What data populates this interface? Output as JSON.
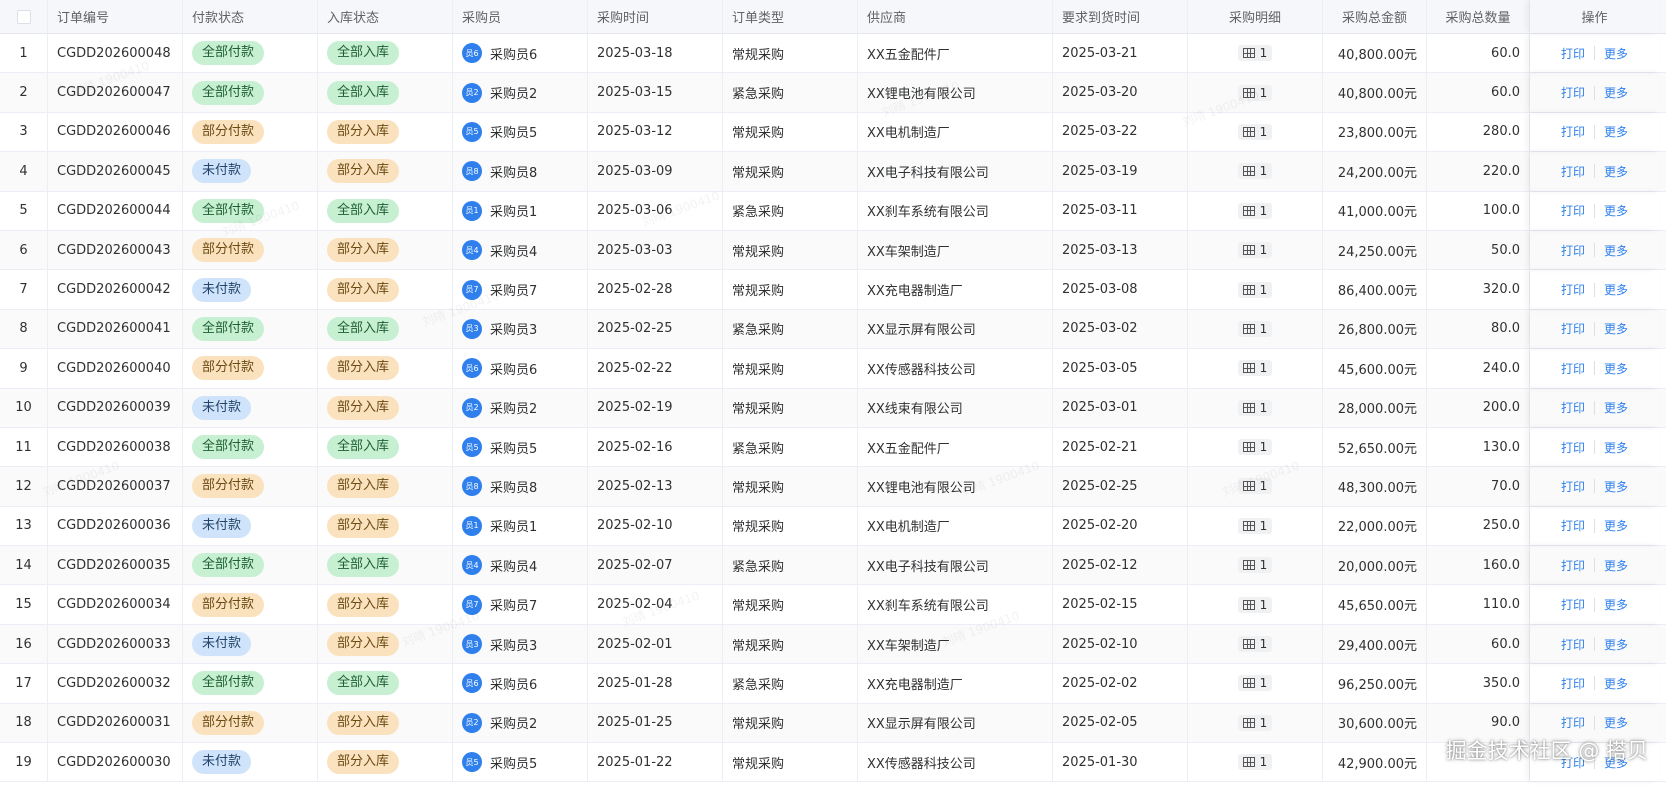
{
  "columns": [
    "",
    "订单编号",
    "付款状态",
    "入库状态",
    "采购员",
    "采购时间",
    "订单类型",
    "供应商",
    "要求到货时间",
    "采购明细",
    "采购总金额",
    "采购总数量",
    "操作"
  ],
  "actions": {
    "print": "打印",
    "more": "更多"
  },
  "watermark": "刘晴 1900410",
  "brand": "掘金技术社区 @ 搭贝",
  "colors": {
    "accent": "#2f80ed",
    "green_tag": "#c7efd2",
    "orange_tag": "#fbe2bf",
    "blue_tag": "#cfe3fb"
  },
  "rows": [
    {
      "idx": "1",
      "order": "CGDD202600048",
      "pay": "全部付款",
      "pay_color": "green",
      "stock": "全部入库",
      "stock_color": "green",
      "avatar": "员6",
      "buyer": "采购员6",
      "date": "2025-03-18",
      "type": "常规采购",
      "supplier": "XX五金配件厂",
      "due": "2025-03-21",
      "detail": "1",
      "amount": "40,800.00元",
      "qty": "60.0"
    },
    {
      "idx": "2",
      "order": "CGDD202600047",
      "pay": "全部付款",
      "pay_color": "green",
      "stock": "全部入库",
      "stock_color": "green",
      "avatar": "员2",
      "buyer": "采购员2",
      "date": "2025-03-15",
      "type": "紧急采购",
      "supplier": "XX锂电池有限公司",
      "due": "2025-03-20",
      "detail": "1",
      "amount": "40,800.00元",
      "qty": "60.0"
    },
    {
      "idx": "3",
      "order": "CGDD202600046",
      "pay": "部分付款",
      "pay_color": "orange",
      "stock": "部分入库",
      "stock_color": "orange",
      "avatar": "员5",
      "buyer": "采购员5",
      "date": "2025-03-12",
      "type": "常规采购",
      "supplier": "XX电机制造厂",
      "due": "2025-03-22",
      "detail": "1",
      "amount": "23,800.00元",
      "qty": "280.0"
    },
    {
      "idx": "4",
      "order": "CGDD202600045",
      "pay": "未付款",
      "pay_color": "blue",
      "stock": "部分入库",
      "stock_color": "orange",
      "avatar": "员8",
      "buyer": "采购员8",
      "date": "2025-03-09",
      "type": "常规采购",
      "supplier": "XX电子科技有限公司",
      "due": "2025-03-19",
      "detail": "1",
      "amount": "24,200.00元",
      "qty": "220.0"
    },
    {
      "idx": "5",
      "order": "CGDD202600044",
      "pay": "全部付款",
      "pay_color": "green",
      "stock": "全部入库",
      "stock_color": "green",
      "avatar": "员1",
      "buyer": "采购员1",
      "date": "2025-03-06",
      "type": "紧急采购",
      "supplier": "XX刹车系统有限公司",
      "due": "2025-03-11",
      "detail": "1",
      "amount": "41,000.00元",
      "qty": "100.0"
    },
    {
      "idx": "6",
      "order": "CGDD202600043",
      "pay": "部分付款",
      "pay_color": "orange",
      "stock": "部分入库",
      "stock_color": "orange",
      "avatar": "员4",
      "buyer": "采购员4",
      "date": "2025-03-03",
      "type": "常规采购",
      "supplier": "XX车架制造厂",
      "due": "2025-03-13",
      "detail": "1",
      "amount": "24,250.00元",
      "qty": "50.0"
    },
    {
      "idx": "7",
      "order": "CGDD202600042",
      "pay": "未付款",
      "pay_color": "blue",
      "stock": "部分入库",
      "stock_color": "orange",
      "avatar": "员7",
      "buyer": "采购员7",
      "date": "2025-02-28",
      "type": "常规采购",
      "supplier": "XX充电器制造厂",
      "due": "2025-03-08",
      "detail": "1",
      "amount": "86,400.00元",
      "qty": "320.0"
    },
    {
      "idx": "8",
      "order": "CGDD202600041",
      "pay": "全部付款",
      "pay_color": "green",
      "stock": "全部入库",
      "stock_color": "green",
      "avatar": "员3",
      "buyer": "采购员3",
      "date": "2025-02-25",
      "type": "紧急采购",
      "supplier": "XX显示屏有限公司",
      "due": "2025-03-02",
      "detail": "1",
      "amount": "26,800.00元",
      "qty": "80.0"
    },
    {
      "idx": "9",
      "order": "CGDD202600040",
      "pay": "部分付款",
      "pay_color": "orange",
      "stock": "部分入库",
      "stock_color": "orange",
      "avatar": "员6",
      "buyer": "采购员6",
      "date": "2025-02-22",
      "type": "常规采购",
      "supplier": "XX传感器科技公司",
      "due": "2025-03-05",
      "detail": "1",
      "amount": "45,600.00元",
      "qty": "240.0"
    },
    {
      "idx": "10",
      "order": "CGDD202600039",
      "pay": "未付款",
      "pay_color": "blue",
      "stock": "部分入库",
      "stock_color": "orange",
      "avatar": "员2",
      "buyer": "采购员2",
      "date": "2025-02-19",
      "type": "常规采购",
      "supplier": "XX线束有限公司",
      "due": "2025-03-01",
      "detail": "1",
      "amount": "28,000.00元",
      "qty": "200.0"
    },
    {
      "idx": "11",
      "order": "CGDD202600038",
      "pay": "全部付款",
      "pay_color": "green",
      "stock": "全部入库",
      "stock_color": "green",
      "avatar": "员5",
      "buyer": "采购员5",
      "date": "2025-02-16",
      "type": "紧急采购",
      "supplier": "XX五金配件厂",
      "due": "2025-02-21",
      "detail": "1",
      "amount": "52,650.00元",
      "qty": "130.0"
    },
    {
      "idx": "12",
      "order": "CGDD202600037",
      "pay": "部分付款",
      "pay_color": "orange",
      "stock": "部分入库",
      "stock_color": "orange",
      "avatar": "员8",
      "buyer": "采购员8",
      "date": "2025-02-13",
      "type": "常规采购",
      "supplier": "XX锂电池有限公司",
      "due": "2025-02-25",
      "detail": "1",
      "amount": "48,300.00元",
      "qty": "70.0"
    },
    {
      "idx": "13",
      "order": "CGDD202600036",
      "pay": "未付款",
      "pay_color": "blue",
      "stock": "部分入库",
      "stock_color": "orange",
      "avatar": "员1",
      "buyer": "采购员1",
      "date": "2025-02-10",
      "type": "常规采购",
      "supplier": "XX电机制造厂",
      "due": "2025-02-20",
      "detail": "1",
      "amount": "22,000.00元",
      "qty": "250.0"
    },
    {
      "idx": "14",
      "order": "CGDD202600035",
      "pay": "全部付款",
      "pay_color": "green",
      "stock": "全部入库",
      "stock_color": "green",
      "avatar": "员4",
      "buyer": "采购员4",
      "date": "2025-02-07",
      "type": "紧急采购",
      "supplier": "XX电子科技有限公司",
      "due": "2025-02-12",
      "detail": "1",
      "amount": "20,000.00元",
      "qty": "160.0"
    },
    {
      "idx": "15",
      "order": "CGDD202600034",
      "pay": "部分付款",
      "pay_color": "orange",
      "stock": "部分入库",
      "stock_color": "orange",
      "avatar": "员7",
      "buyer": "采购员7",
      "date": "2025-02-04",
      "type": "常规采购",
      "supplier": "XX刹车系统有限公司",
      "due": "2025-02-15",
      "detail": "1",
      "amount": "45,650.00元",
      "qty": "110.0"
    },
    {
      "idx": "16",
      "order": "CGDD202600033",
      "pay": "未付款",
      "pay_color": "blue",
      "stock": "部分入库",
      "stock_color": "orange",
      "avatar": "员3",
      "buyer": "采购员3",
      "date": "2025-02-01",
      "type": "常规采购",
      "supplier": "XX车架制造厂",
      "due": "2025-02-10",
      "detail": "1",
      "amount": "29,400.00元",
      "qty": "60.0"
    },
    {
      "idx": "17",
      "order": "CGDD202600032",
      "pay": "全部付款",
      "pay_color": "green",
      "stock": "全部入库",
      "stock_color": "green",
      "avatar": "员6",
      "buyer": "采购员6",
      "date": "2025-01-28",
      "type": "紧急采购",
      "supplier": "XX充电器制造厂",
      "due": "2025-02-02",
      "detail": "1",
      "amount": "96,250.00元",
      "qty": "350.0"
    },
    {
      "idx": "18",
      "order": "CGDD202600031",
      "pay": "部分付款",
      "pay_color": "orange",
      "stock": "部分入库",
      "stock_color": "orange",
      "avatar": "员2",
      "buyer": "采购员2",
      "date": "2025-01-25",
      "type": "常规采购",
      "supplier": "XX显示屏有限公司",
      "due": "2025-02-05",
      "detail": "1",
      "amount": "30,600.00元",
      "qty": "90.0"
    },
    {
      "idx": "19",
      "order": "CGDD202600030",
      "pay": "未付款",
      "pay_color": "blue",
      "stock": "部分入库",
      "stock_color": "orange",
      "avatar": "员5",
      "buyer": "采购员5",
      "date": "2025-01-22",
      "type": "常规采购",
      "supplier": "XX传感器科技公司",
      "due": "2025-01-30",
      "detail": "1",
      "amount": "42,900.00元",
      "qty": ""
    }
  ]
}
